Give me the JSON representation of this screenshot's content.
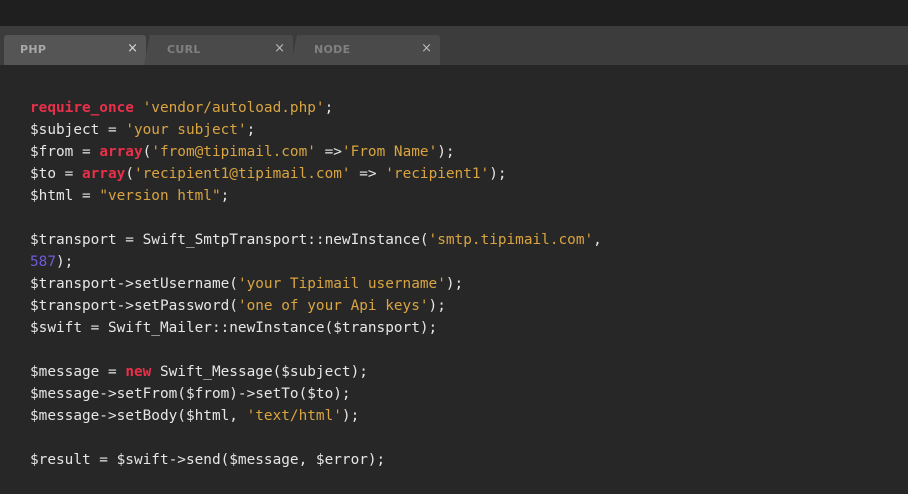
{
  "tabs": [
    {
      "label": "PHP",
      "close": "×",
      "active": true
    },
    {
      "label": "CURL",
      "close": "×",
      "active": false
    },
    {
      "label": "NODE",
      "close": "×",
      "active": false
    }
  ],
  "code": {
    "lines": [
      [
        {
          "t": "require_once",
          "c": "kw"
        },
        {
          "t": " ",
          "c": ""
        },
        {
          "t": "'vendor/autoload.php'",
          "c": "str"
        },
        {
          "t": ";",
          "c": ""
        }
      ],
      [
        {
          "t": "$subject = ",
          "c": ""
        },
        {
          "t": "'your subject'",
          "c": "str"
        },
        {
          "t": ";",
          "c": ""
        }
      ],
      [
        {
          "t": "$from = ",
          "c": ""
        },
        {
          "t": "array",
          "c": "kw"
        },
        {
          "t": "(",
          "c": ""
        },
        {
          "t": "'from@tipimail.com'",
          "c": "str"
        },
        {
          "t": " =>",
          "c": ""
        },
        {
          "t": "'From Name'",
          "c": "str"
        },
        {
          "t": ");",
          "c": ""
        }
      ],
      [
        {
          "t": "$to = ",
          "c": ""
        },
        {
          "t": "array",
          "c": "kw"
        },
        {
          "t": "(",
          "c": ""
        },
        {
          "t": "'recipient1@tipimail.com'",
          "c": "str"
        },
        {
          "t": " => ",
          "c": ""
        },
        {
          "t": "'recipient1'",
          "c": "str"
        },
        {
          "t": ");",
          "c": ""
        }
      ],
      [
        {
          "t": "$html = ",
          "c": ""
        },
        {
          "t": "\"version html\"",
          "c": "str"
        },
        {
          "t": ";",
          "c": ""
        }
      ],
      [],
      [
        {
          "t": "$transport = Swift_SmtpTransport::newInstance(",
          "c": ""
        },
        {
          "t": "'smtp.tipimail.com'",
          "c": "str"
        },
        {
          "t": ",",
          "c": ""
        }
      ],
      [
        {
          "t": "587",
          "c": "num"
        },
        {
          "t": ");",
          "c": ""
        }
      ],
      [
        {
          "t": "$transport->setUsername(",
          "c": ""
        },
        {
          "t": "'your Tipimail username'",
          "c": "str"
        },
        {
          "t": ");",
          "c": ""
        }
      ],
      [
        {
          "t": "$transport->setPassword(",
          "c": ""
        },
        {
          "t": "'one of your Api keys'",
          "c": "str"
        },
        {
          "t": ");",
          "c": ""
        }
      ],
      [
        {
          "t": "$swift = Swift_Mailer::newInstance($transport);",
          "c": ""
        }
      ],
      [],
      [
        {
          "t": "$message = ",
          "c": ""
        },
        {
          "t": "new",
          "c": "kw"
        },
        {
          "t": " Swift_Message($subject);",
          "c": ""
        }
      ],
      [
        {
          "t": "$message->setFrom($from)->setTo($to);",
          "c": ""
        }
      ],
      [
        {
          "t": "$message->setBody($html, ",
          "c": ""
        },
        {
          "t": "'text/html'",
          "c": "str"
        },
        {
          "t": ");",
          "c": ""
        }
      ],
      [],
      [
        {
          "t": "$result = $swift->send($message, $error);",
          "c": ""
        }
      ]
    ]
  }
}
